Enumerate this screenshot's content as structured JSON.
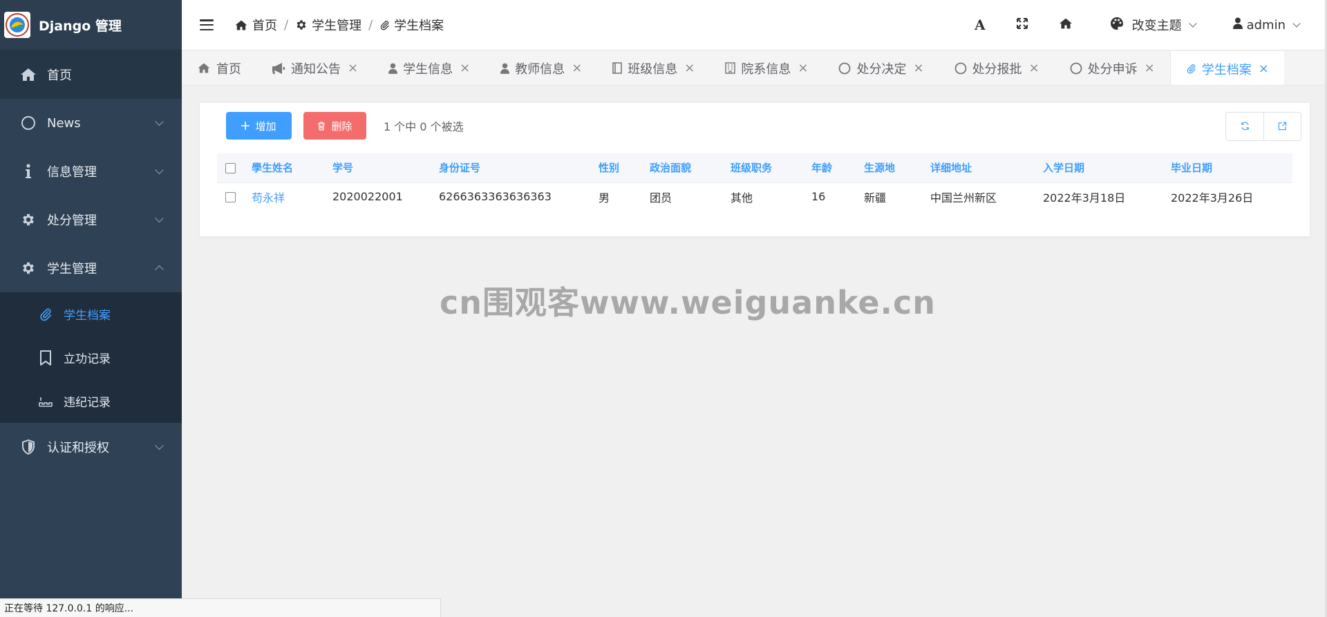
{
  "app": {
    "title": "Django 管理"
  },
  "sidebar": {
    "items": [
      {
        "label": "首页",
        "icon": "home-icon"
      },
      {
        "label": "News",
        "icon": "circle-icon"
      },
      {
        "label": "信息管理",
        "icon": "info-icon"
      },
      {
        "label": "处分管理",
        "icon": "gear-icon"
      },
      {
        "label": "学生管理",
        "icon": "gear-icon"
      },
      {
        "label": "认证和授权",
        "icon": "shield-icon"
      }
    ],
    "sub_items": [
      {
        "label": "学生档案",
        "icon": "paperclip-icon"
      },
      {
        "label": "立功记录",
        "icon": "bookmark-icon"
      },
      {
        "label": "违纪记录",
        "icon": "ruler-icon"
      }
    ]
  },
  "header": {
    "breadcrumb": [
      "首页",
      "学生管理",
      "学生档案"
    ],
    "breadcrumb_sep": "/",
    "font_label": "A",
    "theme_label": "改变主题",
    "user": "admin"
  },
  "tabs": [
    {
      "label": "首页"
    },
    {
      "label": "通知公告"
    },
    {
      "label": "学生信息"
    },
    {
      "label": "教师信息"
    },
    {
      "label": "班级信息"
    },
    {
      "label": "院系信息"
    },
    {
      "label": "处分决定"
    },
    {
      "label": "处分报批"
    },
    {
      "label": "处分申诉"
    },
    {
      "label": "学生档案"
    }
  ],
  "tab_close": "×",
  "toolbar": {
    "add_label": "增加",
    "delete_label": "删除",
    "selection_text": "1 个中 0 个被选"
  },
  "table": {
    "headers": [
      "學生姓名",
      "学号",
      "身份证号",
      "性别",
      "政治面貌",
      "班级职务",
      "年龄",
      "生源地",
      "详细地址",
      "入学日期",
      "毕业日期"
    ],
    "rows": [
      [
        "苟永祥",
        "2020022001",
        "6266363363636363",
        "男",
        "团员",
        "其他",
        "16",
        "新疆",
        "中国兰州新区",
        "2022年3月18日",
        "2022年3月26日"
      ]
    ]
  },
  "watermark": "cn围观客www.weiguanke.cn",
  "status_text": "正在等待 127.0.0.1 的响应...",
  "colors": {
    "primary": "#409eff",
    "danger": "#f56c6c",
    "sidebar": "#2f4154"
  }
}
